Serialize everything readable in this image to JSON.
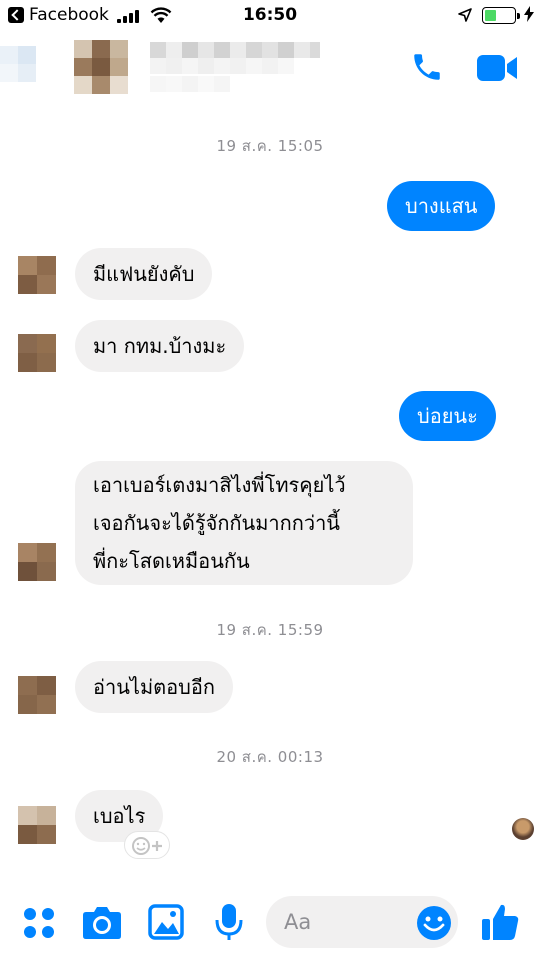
{
  "status_bar": {
    "back_app": "Facebook",
    "time": "16:50"
  },
  "header": {
    "contact_name": "",
    "call_icon": "phone-icon",
    "video_icon": "video-camera-icon"
  },
  "colors": {
    "accent": "#0084ff",
    "incoming_bubble": "#f1f0f0",
    "timestamp_text": "#8e8e93",
    "battery": "#4cd964"
  },
  "messages": [
    {
      "type": "timestamp",
      "text": "19 ส.ค. 15:05"
    },
    {
      "type": "outgoing",
      "text": "บางแสน"
    },
    {
      "type": "incoming",
      "text": "มีแฟนยังคับ"
    },
    {
      "type": "incoming",
      "text": "มา กทม.บ้างมะ"
    },
    {
      "type": "outgoing",
      "text": "บ่อยนะ"
    },
    {
      "type": "incoming",
      "lines": [
        "เอาเบอร์เตงมาสิไงพี่โทรคุยไว้",
        "เจอกันจะได้รู้จักกันมากกว่านี้",
        "พี่กะโสดเหมือนกัน"
      ]
    },
    {
      "type": "timestamp",
      "text": "19 ส.ค. 15:59"
    },
    {
      "type": "incoming",
      "text": "อ่านไม่ตอบอีก"
    },
    {
      "type": "timestamp",
      "text": "20 ส.ค. 00:13"
    },
    {
      "type": "incoming",
      "text": "เบอไร"
    }
  ],
  "composer": {
    "placeholder": "Aa",
    "value": "",
    "icons": [
      "apps-icon",
      "camera-icon",
      "gallery-icon",
      "microphone-icon",
      "emoji-icon",
      "thumbs-up-icon"
    ]
  }
}
